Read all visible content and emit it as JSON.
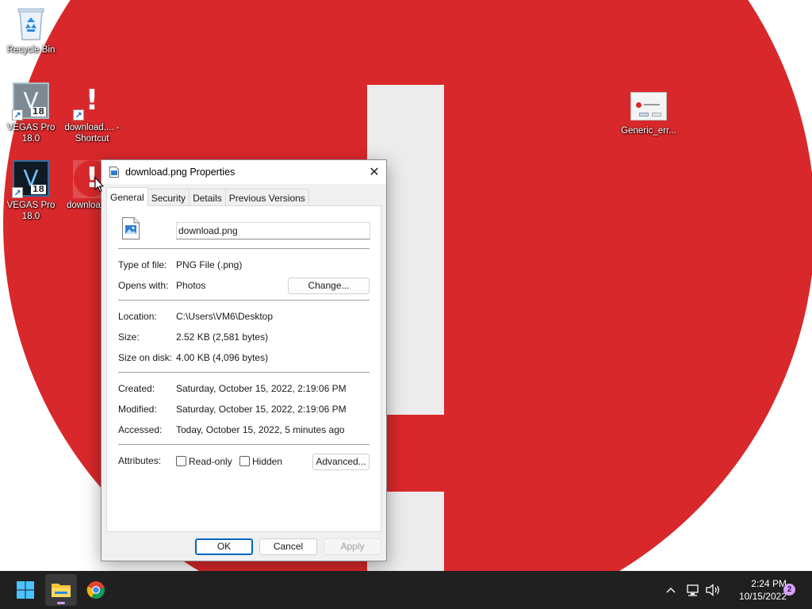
{
  "desktop": {
    "icons": [
      {
        "label": "Recycle Bin"
      },
      {
        "label": "VEGAS Pro 18.0"
      },
      {
        "label": "download.... - Shortcut"
      },
      {
        "label": "VEGAS Pro 18.0"
      },
      {
        "label": "downloa"
      },
      {
        "label": "Generic_err..."
      }
    ],
    "vegas_glyph": "V",
    "vegas_version_badge": "18",
    "error_glyph": "!"
  },
  "dialog": {
    "title": "download.png Properties",
    "close_glyph": "✕",
    "tabs": [
      {
        "label": "General"
      },
      {
        "label": "Security"
      },
      {
        "label": "Details"
      },
      {
        "label": "Previous Versions"
      }
    ],
    "filename": "download.png",
    "type_label": "Type of file:",
    "type_value": "PNG File (.png)",
    "opens_label": "Opens with:",
    "opens_value": "Photos",
    "change_button": "Change...",
    "location_label": "Location:",
    "location_value": "C:\\Users\\VM6\\Desktop",
    "size_label": "Size:",
    "size_value": "2.52 KB (2,581 bytes)",
    "size_on_disk_label": "Size on disk:",
    "size_on_disk_value": "4.00 KB (4,096 bytes)",
    "created_label": "Created:",
    "created_value": "Saturday, October 15, 2022, 2:19:06 PM",
    "modified_label": "Modified:",
    "modified_value": "Saturday, October 15, 2022, 2:19:06 PM",
    "accessed_label": "Accessed:",
    "accessed_value": "Today, October 15, 2022, 5 minutes ago",
    "attributes_label": "Attributes:",
    "readonly_label": "Read-only",
    "hidden_label": "Hidden",
    "advanced_button": "Advanced...",
    "ok_button": "OK",
    "cancel_button": "Cancel",
    "apply_button": "Apply"
  },
  "taskbar": {
    "time": "2:24 PM",
    "date": "10/15/2022",
    "notification_count": "2",
    "tray_chevron": "^"
  },
  "colors": {
    "wallpaper_red": "#d9282b",
    "taskbar": "#202020",
    "accent": "#0067c0",
    "badge": "#d7a2ff"
  }
}
